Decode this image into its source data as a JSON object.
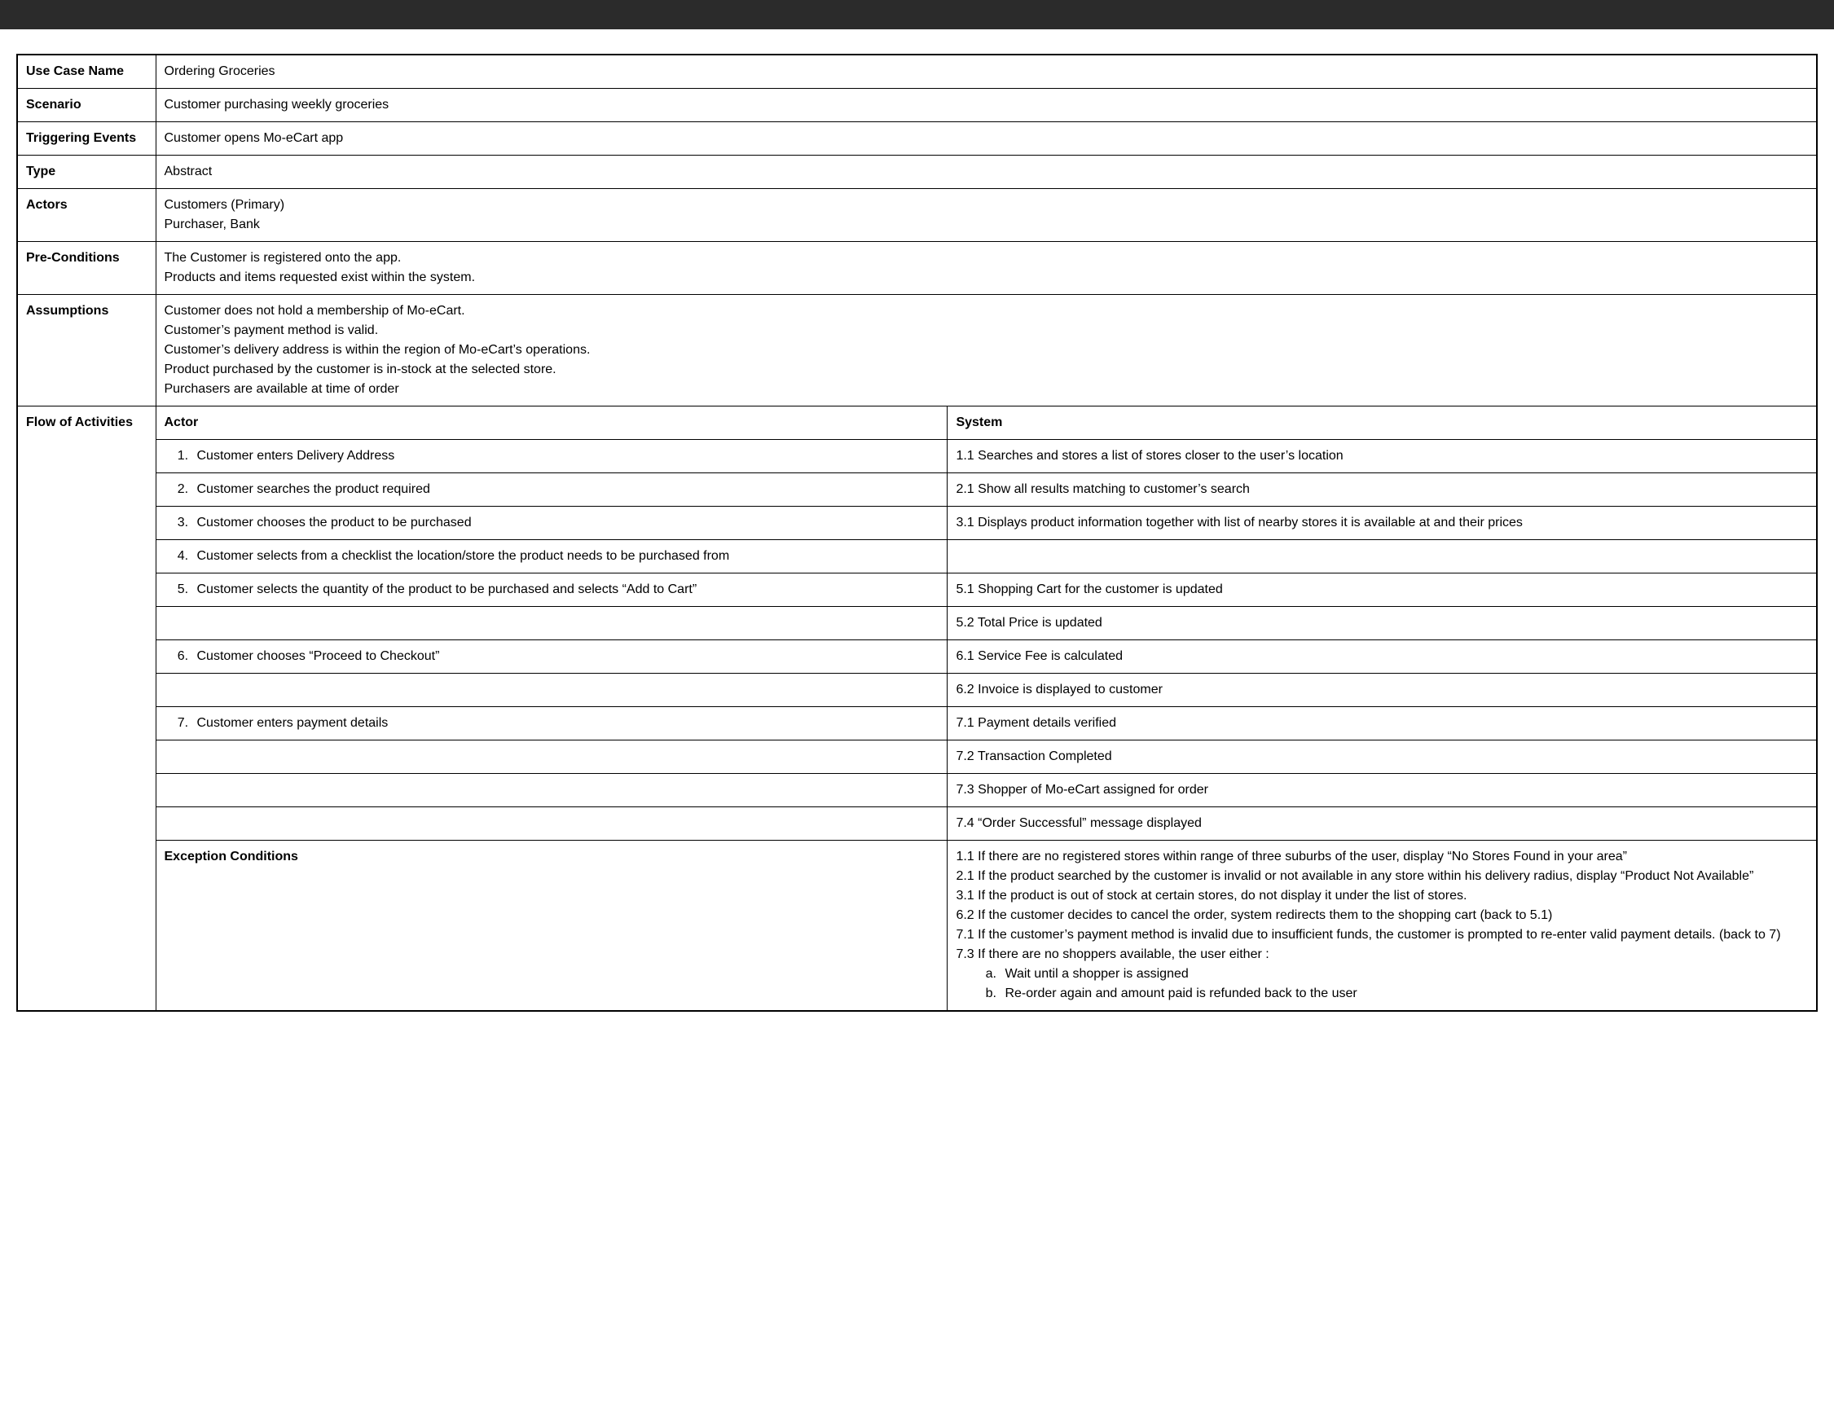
{
  "rows": {
    "useCaseName": {
      "label": "Use Case Name",
      "value": "Ordering Groceries"
    },
    "scenario": {
      "label": "Scenario",
      "value": "Customer purchasing weekly groceries"
    },
    "triggeringEvents": {
      "label": "Triggering Events",
      "value": "Customer opens Mo-eCart app"
    },
    "type": {
      "label": "Type",
      "value": "Abstract"
    },
    "actors": {
      "label": "Actors",
      "line1": "Customers (Primary)",
      "line2": "Purchaser, Bank"
    },
    "preConditions": {
      "label": "Pre-Conditions",
      "line1": "The Customer is registered onto the app.",
      "line2": "Products and items requested exist within the system."
    },
    "assumptions": {
      "label": "Assumptions",
      "line1": "Customer does not hold a membership of Mo-eCart.",
      "line2": "Customer’s payment method is valid.",
      "line3": "Customer’s delivery address is within the region of Mo-eCart’s operations.",
      "line4": "Product purchased by the customer is in-stock at the selected store.",
      "line5": "Purchasers are available at time of order"
    },
    "flow": {
      "label": "Flow of Activities",
      "actorHeader": "Actor",
      "systemHeader": "System",
      "steps": {
        "a1": "Customer enters Delivery Address",
        "s1": "1.1 Searches and stores a list of stores closer to the user’s location",
        "a2": "Customer searches the product required",
        "s2": "2.1 Show all results matching to customer’s search",
        "a3": "Customer chooses the product to be purchased",
        "s3": "3.1 Displays product information together with list of nearby stores it is available at and their prices",
        "a4": "Customer selects from a checklist the location/store the product needs to be purchased from",
        "a5": "Customer selects the quantity of the product to be purchased and selects “Add to Cart”",
        "s5": "5.1 Shopping Cart for the customer is updated",
        "s5b": "5.2 Total Price is updated",
        "a6": "Customer chooses “Proceed to Checkout”",
        "s6": "6.1 Service Fee is calculated",
        "s6b": "6.2 Invoice is displayed to customer",
        "a7": "Customer enters payment details",
        "s7a": "7.1 Payment details verified",
        "s7b": "7.2 Transaction Completed",
        "s7c": "7.3 Shopper of Mo-eCart assigned for order",
        "s7d": "7.4 “Order Successful” message displayed"
      }
    },
    "exceptions": {
      "label": "Exception Conditions",
      "line1": "1.1 If there are no registered stores within range of three suburbs of the user, display “No Stores Found in your area”",
      "line2": "2.1 If the product searched by the customer is invalid or not available in any store within his delivery radius, display “Product Not Available”",
      "line3": "3.1 If the product is out of stock at certain stores, do not display it under the list of stores.",
      "line4": "6.2 If the customer decides to cancel the order, system redirects them to the shopping cart (back to 5.1)",
      "line5": "7.1 If the customer’s payment method is invalid due to insufficient funds, the customer is prompted to re-enter valid payment details. (back to 7)",
      "line6": "7.3 If there are no shoppers available, the user either :",
      "subA": "Wait until a shopper is assigned",
      "subB": "Re-order again and amount paid is refunded back to the user"
    }
  }
}
